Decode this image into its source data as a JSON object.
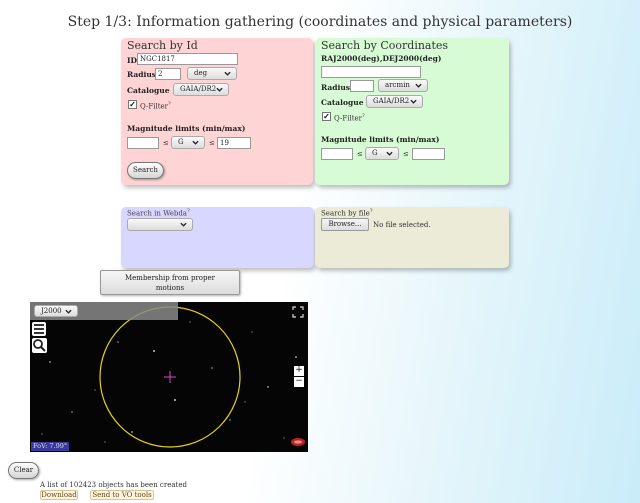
{
  "header": {
    "title": "Step 1/3: Information gathering (coordinates and physical parameters)"
  },
  "search_by_id": {
    "title": "Search by Id",
    "id_label": "ID",
    "id_value": "NGC1817",
    "radius_label": "Radius",
    "radius_value": "2",
    "radius_unit": "deg",
    "catalogue_label": "Catalogue",
    "catalogue_value": "GAIA/DR2",
    "qfilter_label": "Q-Filter",
    "qfilter_sup": "?",
    "qfilter_checked": true,
    "mag_label": "Magnitude limits (min/max)",
    "mag_min": "",
    "mag_le1": "≤",
    "mag_band": "G",
    "mag_le2": "≤",
    "mag_max": "19",
    "search_button": "Search"
  },
  "search_by_coordinates": {
    "title": "Search by Coordinates",
    "coord_label": "RAJ2000(deg),DEJ2000(deg)",
    "coord_value": "",
    "radius_label": "Radius",
    "radius_value": "",
    "radius_unit": "arcmin",
    "catalogue_label": "Catalogue",
    "catalogue_value": "GAIA/DR2",
    "qfilter_label": "Q-Filter",
    "qfilter_sup": "?",
    "qfilter_checked": true,
    "mag_label": "Magnitude limits (min/max)",
    "mag_min": "",
    "mag_le1": "≤",
    "mag_band": "G",
    "mag_le2": "≤",
    "mag_max": ""
  },
  "webda": {
    "label": "Search in Webda",
    "sup": "?",
    "value": ""
  },
  "file": {
    "label": "Search by file",
    "sup": "?",
    "browse_button": "Browse...",
    "status": "No file selected."
  },
  "membership_button": {
    "line1": "Membership from proper",
    "line2": "motions"
  },
  "sky_viewer": {
    "frame_value": "J2000",
    "fov_label": "FoV: 7.99°",
    "zoom_in": "+",
    "zoom_out": "−",
    "circle_color": "#e6d21a",
    "marker_color": "#d04ad0"
  },
  "clear_button": "Clear",
  "status": {
    "message": "A list of 102423 objects has been created"
  },
  "actions": {
    "download": "Download",
    "send_vo": "Send to VO tools"
  }
}
